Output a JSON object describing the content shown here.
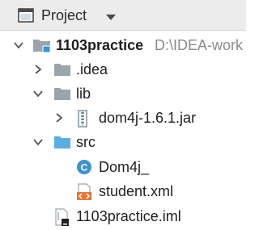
{
  "header": {
    "title": "Project",
    "window_icon": "project-window-icon",
    "dropdown_icon": "chevron-down-icon"
  },
  "tree": {
    "root": {
      "name": "1103practice",
      "path": "D:\\IDEA-work",
      "icon": "module-folder-icon",
      "expanded": true
    },
    "idea": {
      "name": ".idea",
      "icon": "folder-icon",
      "expanded": false
    },
    "lib": {
      "name": "lib",
      "icon": "folder-icon",
      "expanded": true
    },
    "jar": {
      "name": "dom4j-1.6.1.jar",
      "icon": "jar-icon",
      "expanded": false
    },
    "src": {
      "name": "src",
      "icon": "source-folder-icon",
      "expanded": true
    },
    "dom4j_class": {
      "name": "Dom4j_",
      "icon": "java-class-icon",
      "badge": "C"
    },
    "student_xml": {
      "name": "student.xml",
      "icon": "xml-file-icon"
    },
    "iml": {
      "name": "1103practice.iml",
      "icon": "iml-file-icon"
    }
  },
  "colors": {
    "header_bg": "#ececec",
    "folder_gray": "#9aa4ab",
    "source_folder_blue": "#5aaee0",
    "class_blue": "#3e93cf",
    "xml_orange": "#e8763a",
    "path_gray": "#8a8a8a"
  }
}
